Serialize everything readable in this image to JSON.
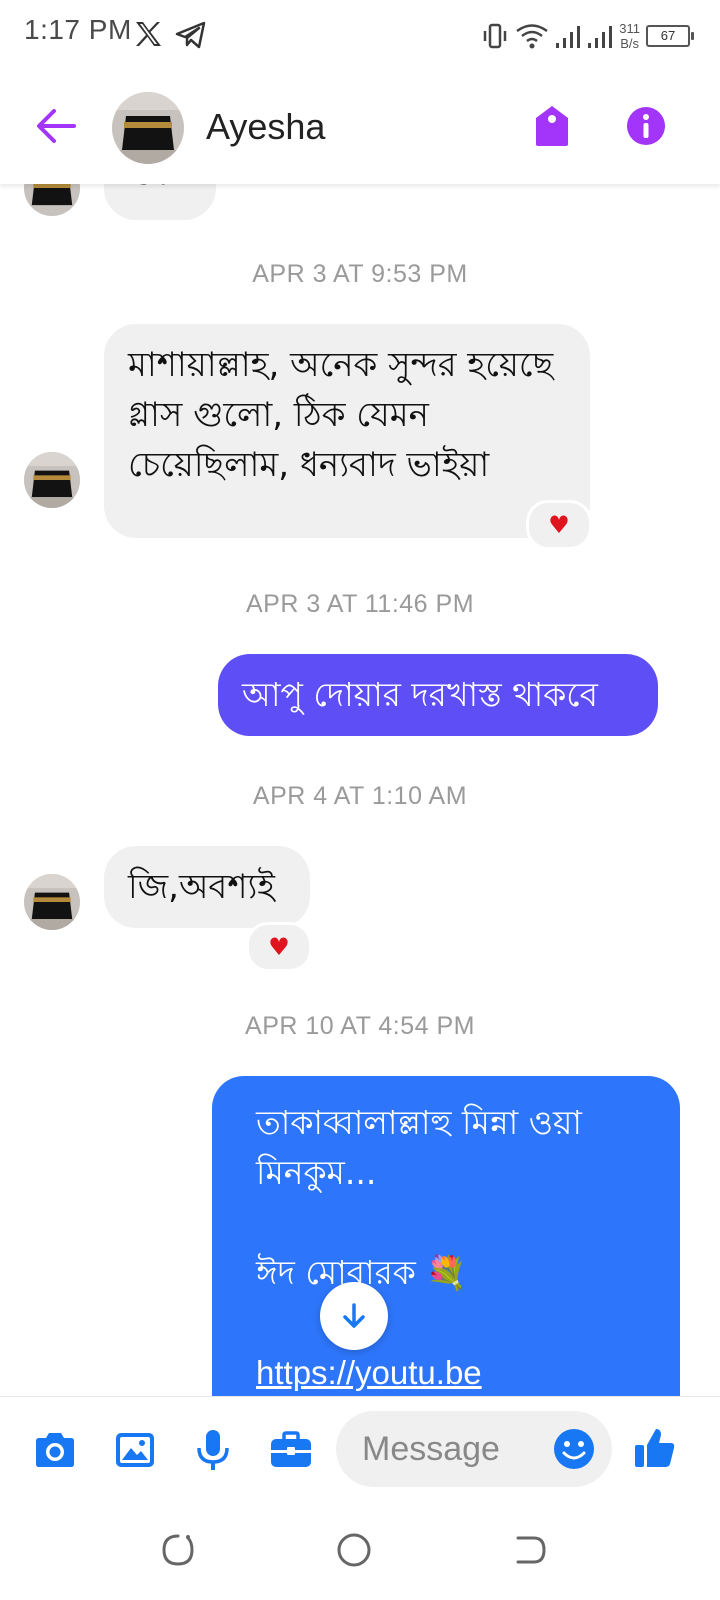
{
  "status_bar": {
    "time": "1:17 PM",
    "net_speed_value": "311",
    "net_speed_unit": "B/s",
    "battery": "67"
  },
  "header": {
    "contact_name": "Ayesha",
    "accent_color": "#a334fa"
  },
  "messages": [
    {
      "type": "incoming",
      "text": "ওকে",
      "partial": true
    },
    {
      "type": "timestamp",
      "text": "APR 3 AT 9:53 PM"
    },
    {
      "type": "incoming",
      "text": "মাশায়াল্লাহ, অনেক সুন্দর হয়েছে গ্লাস গুলো, ঠিক যেমন চেয়েছিলাম, ধন্যবাদ ভাইয়া",
      "reaction": "heart"
    },
    {
      "type": "timestamp",
      "text": "APR 3 AT 11:46 PM"
    },
    {
      "type": "outgoing",
      "text": "আপু দোয়ার দরখাস্ত থাকবে",
      "color": "#5d4ef6"
    },
    {
      "type": "timestamp",
      "text": "APR 4 AT 1:10 AM"
    },
    {
      "type": "incoming",
      "text": "জি,অবশ্যই",
      "reaction": "heart"
    },
    {
      "type": "timestamp",
      "text": "APR 10 AT 4:54 PM"
    },
    {
      "type": "outgoing",
      "line1": "তাকাব্বালাল্লাহু মিন্না ওয়া",
      "line2": "মিনকুম...",
      "line3": "ঈদ মোবারক 💐",
      "link": "https://youtu.be",
      "color": "#2d76fb"
    }
  ],
  "composer": {
    "placeholder": "Message",
    "icon_color": "#1877f2"
  },
  "icons": {
    "reaction": "♥",
    "back": "arrow-left-icon",
    "tag": "tag-icon",
    "info": "info-icon",
    "camera": "camera-icon",
    "gallery": "image-icon",
    "mic": "microphone-icon",
    "briefcase": "briefcase-icon",
    "emoji": "smiley-icon",
    "like": "thumbs-up-icon"
  }
}
